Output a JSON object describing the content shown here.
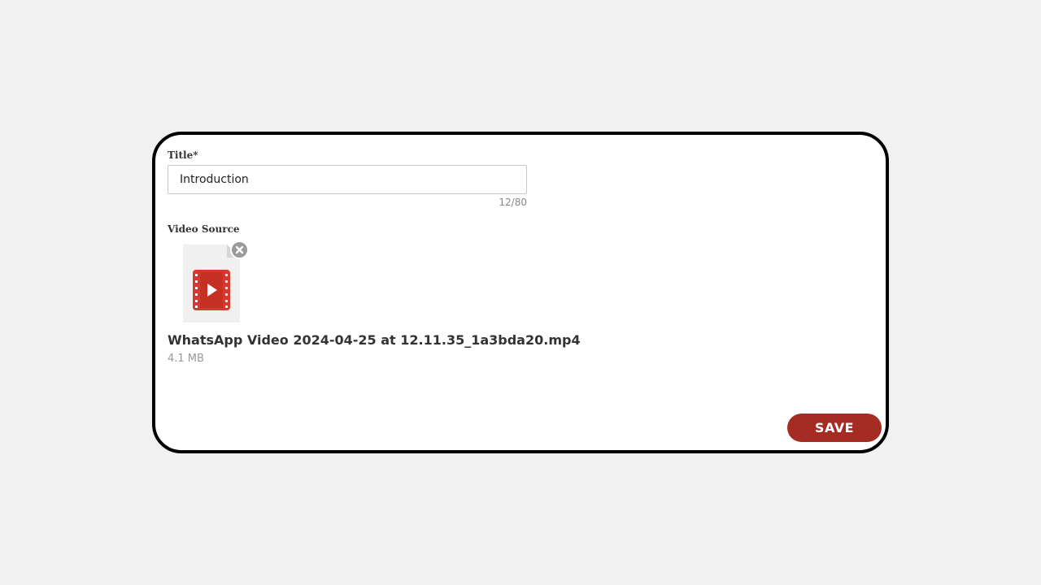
{
  "form": {
    "title_label": "Title*",
    "title_value": "Introduction",
    "title_char_count": "12/80",
    "video_source_label": "Video Source"
  },
  "video_file": {
    "icon": "video-file-icon",
    "remove_icon": "close-circle-icon",
    "name": "WhatsApp Video 2024-04-25 at 12.11.35_1a3bda20.mp4",
    "size": "4.1 MB"
  },
  "actions": {
    "save_label": "SAVE"
  },
  "colors": {
    "accent": "#a52c22",
    "video_icon": "#d9372b",
    "background": "#f1f1f1"
  }
}
